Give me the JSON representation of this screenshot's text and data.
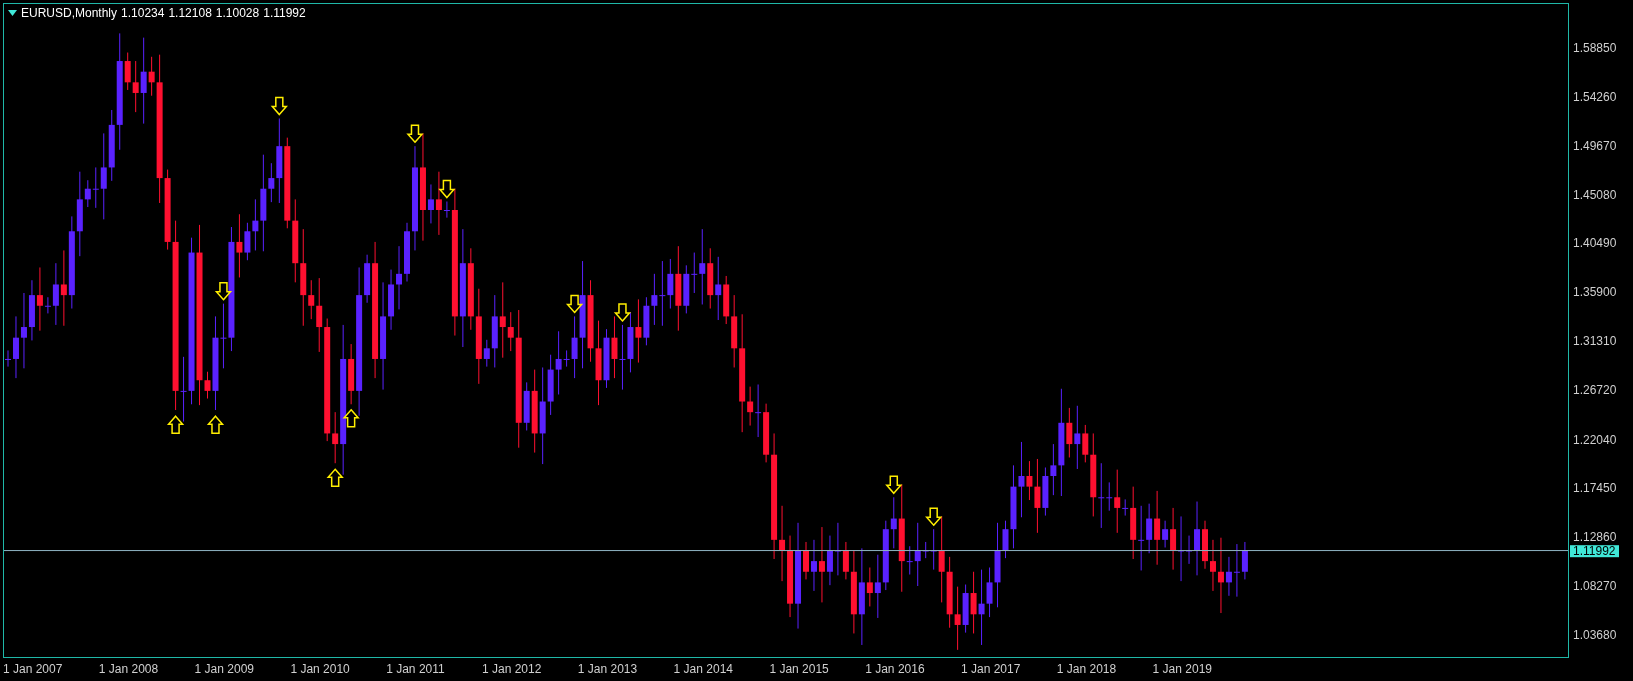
{
  "title": {
    "symbol": "EURUSD,Monthly",
    "values": [
      "1.10234",
      "1.12108",
      "1.10028",
      "1.11992"
    ]
  },
  "price_axis": {
    "labels": [
      "1.58850",
      "1.54260",
      "1.49670",
      "1.45080",
      "1.40490",
      "1.35900",
      "1.31310",
      "1.26720",
      "1.22040",
      "1.17450",
      "1.12860",
      "1.08270",
      "1.03680"
    ]
  },
  "current_price": "1.11992",
  "time_axis": {
    "labels": [
      "1 Jan 2007",
      "1 Jan 2008",
      "1 Jan 2009",
      "1 Jan 2010",
      "1 Jan 2011",
      "1 Jan 2012",
      "1 Jan 2013",
      "1 Jan 2014",
      "1 Jan 2015",
      "1 Jan 2016",
      "1 Jan 2017",
      "1 Jan 2018",
      "1 Jan 2019"
    ]
  }
}
